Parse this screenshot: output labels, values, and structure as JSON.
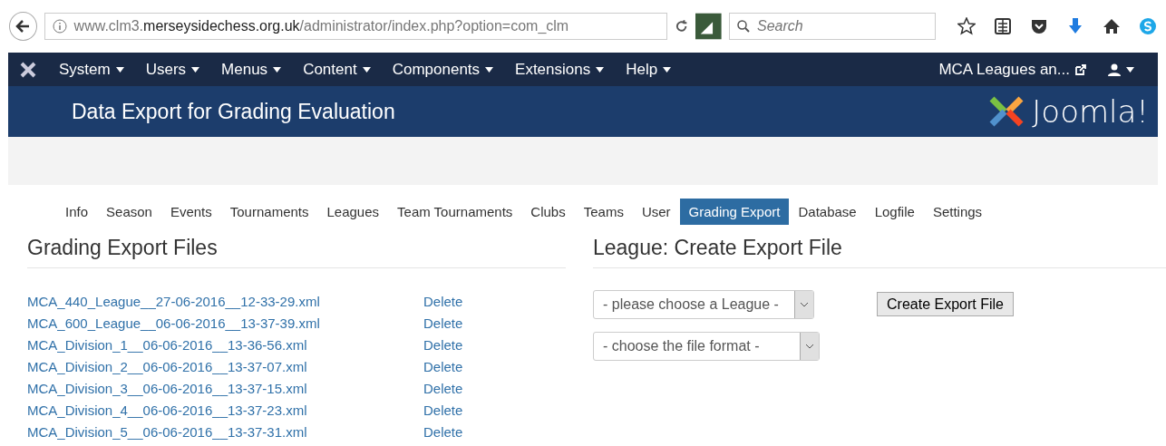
{
  "browser": {
    "url": "www.clm3.**merseysidechess.org.uk**/administrator/index.php?option=com_clm",
    "search": {
      "placeholder": "Search"
    }
  },
  "menu": {
    "items": [
      "System",
      "Users",
      "Menus",
      "Content",
      "Components",
      "Extensions",
      "Help"
    ],
    "site_link": "MCA Leagues an..."
  },
  "header": {
    "title": "Data Export for Grading Evaluation",
    "logo_text": "Joomla!"
  },
  "tabs": [
    {
      "label": "Info",
      "selected": false
    },
    {
      "label": "Season",
      "selected": false
    },
    {
      "label": "Events",
      "selected": false
    },
    {
      "label": "Tournaments",
      "selected": false
    },
    {
      "label": "Leagues",
      "selected": false
    },
    {
      "label": "Team Tournaments",
      "selected": false
    },
    {
      "label": "Clubs",
      "selected": false
    },
    {
      "label": "Teams",
      "selected": false
    },
    {
      "label": "User",
      "selected": false
    },
    {
      "label": "Grading Export",
      "selected": true
    },
    {
      "label": "Database",
      "selected": false
    },
    {
      "label": "Logfile",
      "selected": false
    },
    {
      "label": "Settings",
      "selected": false
    }
  ],
  "files": {
    "heading": "Grading Export Files",
    "rows": [
      {
        "name": "MCA_440_League__27-06-2016__12-33-29.xml",
        "action": "Delete"
      },
      {
        "name": "MCA_600_League__06-06-2016__13-37-39.xml",
        "action": "Delete"
      },
      {
        "name": "MCA_Division_1__06-06-2016__13-36-56.xml",
        "action": "Delete"
      },
      {
        "name": "MCA_Division_2__06-06-2016__13-37-07.xml",
        "action": "Delete"
      },
      {
        "name": "MCA_Division_3__06-06-2016__13-37-15.xml",
        "action": "Delete"
      },
      {
        "name": "MCA_Division_4__06-06-2016__13-37-23.xml",
        "action": "Delete"
      },
      {
        "name": "MCA_Division_5__06-06-2016__13-37-31.xml",
        "action": "Delete"
      }
    ]
  },
  "create": {
    "heading": "League: Create Export File",
    "league_select": "- please choose a League -",
    "format_select": "- choose the file format -",
    "button": "Create Export File"
  }
}
